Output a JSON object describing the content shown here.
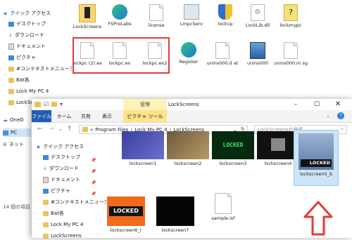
{
  "background_window": {
    "sidebar": {
      "items": [
        {
          "label": "クイック アクセス",
          "pinned": false
        },
        {
          "label": "デスクトップ",
          "pinned": true
        },
        {
          "label": "ダウンロード",
          "pinned": true
        },
        {
          "label": "ドキュメント",
          "pinned": true
        },
        {
          "label": "ピクチャ",
          "pinned": true
        },
        {
          "label": "#コンテキストメニューﾌ",
          "pinned": false
        },
        {
          "label": "Bat各",
          "pinned": false
        },
        {
          "label": "Lock My PC 4",
          "pinned": false
        },
        {
          "label": "LockScreens",
          "pinned": false
        },
        {
          "label": "OneD",
          "pinned": false
        },
        {
          "label": "PC",
          "pinned": false
        },
        {
          "label": "ネット",
          "pinned": false
        }
      ],
      "item_count": "14 個の項目"
    },
    "files_row1": [
      "LockScreens",
      "FSProLabs",
      "license",
      "LmpcServ",
      "lockcp",
      "LockLib.dll",
      "lockmypc"
    ],
    "files_row2": [
      "lockpc (2).ex",
      "lockpc.ex",
      "lockpc.ex2",
      "Register",
      "unins000.d at",
      "unins000",
      "unins000.m sg"
    ]
  },
  "window": {
    "title": "LockScreens",
    "context_tab_group": "管理",
    "ribbon_tabs": [
      "ファイル",
      "ホーム",
      "共有",
      "表示",
      "ピクチャ ツール"
    ],
    "breadcrumb": [
      "Program Files",
      "Lock My PC 4",
      "LockScreens"
    ],
    "search_placeholder": "LockScreensの検索",
    "sidebar": [
      "クイック アクセス",
      "デスクトップ",
      "ダウンロード",
      "ドキュメント",
      "ピクチャ",
      "#コンテキストメニューﾌ",
      "Bat各",
      "Lock My PC 4",
      "LockScreens"
    ],
    "files": [
      {
        "name": "lockscreen1"
      },
      {
        "name": "lockscreen2"
      },
      {
        "name": "lockscreen3"
      },
      {
        "name": "lockscreen4"
      },
      {
        "name": "lockscreen5_b"
      },
      {
        "name": "lockscreen6_r"
      },
      {
        "name": "lockscreen7"
      },
      {
        "name": "sample.isf"
      }
    ],
    "locked_text": "LOCKED",
    "colors": {
      "accent": "#1e5fb4",
      "highlight_red": "#e53935",
      "manage_tab": "#ffe38a",
      "selection": "#cce4f7"
    }
  }
}
